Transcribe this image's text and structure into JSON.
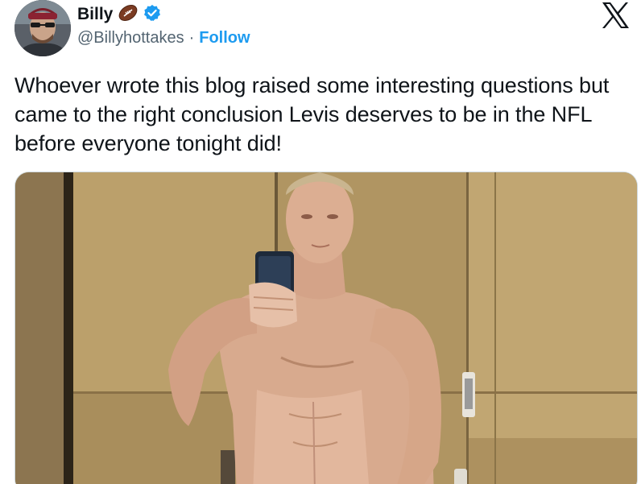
{
  "author": {
    "display_name": "Billy",
    "handle": "@Billyhottakes",
    "separator": "·",
    "follow_label": "Follow",
    "emoji_icon": "football-icon",
    "verified_icon": "verified-badge-icon"
  },
  "brand": {
    "logo_icon": "x-logo-icon"
  },
  "tweet": {
    "text": "Whoever wrote this blog raised some interesting questions but came to the right conclusion Levis deserves to be in the NFL before everyone tonight did!"
  },
  "media": {
    "type": "photo",
    "icon": "photo"
  },
  "colors": {
    "follow": "#1d9bf0",
    "verified": "#1d9bf0",
    "text": "#0f1419",
    "secondary": "#536471"
  }
}
